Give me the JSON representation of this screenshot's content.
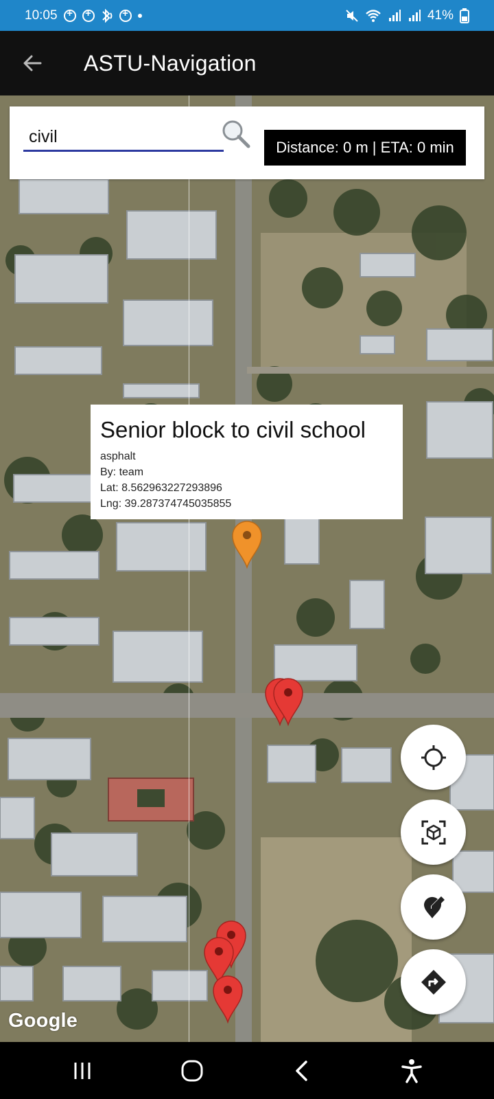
{
  "status_bar": {
    "time": "10:05",
    "battery": "41%",
    "icons": [
      "notification-icon",
      "notification-icon",
      "bluetooth-audio-icon",
      "notification-icon",
      "dot-icon",
      "mute-icon",
      "wifi-icon",
      "signal-icon",
      "signal-icon",
      "battery-icon"
    ]
  },
  "app_bar": {
    "title": "ASTU-Navigation",
    "back_icon": "arrow-left-icon"
  },
  "search": {
    "value": "civil",
    "placeholder": "",
    "search_icon": "magnifier-icon"
  },
  "distance": {
    "label": "Distance: 0 m | ETA: 0 min"
  },
  "info_window": {
    "title": "Senior block to civil school",
    "surface": "asphalt",
    "by": "By: team",
    "lat": "Lat: 8.562963227293896",
    "lng": "Lng: 39.287374745035855"
  },
  "markers": [
    {
      "color": "#f0922a",
      "role": "selected"
    },
    {
      "color": "#e53935",
      "role": "red"
    },
    {
      "color": "#e53935",
      "role": "red"
    },
    {
      "color": "#e53935",
      "role": "red"
    },
    {
      "color": "#e53935",
      "role": "red"
    },
    {
      "color": "#e53935",
      "role": "red"
    }
  ],
  "map": {
    "attribution": "Google"
  },
  "fabs": [
    {
      "name": "my-location-button",
      "icon": "crosshair-icon"
    },
    {
      "name": "ar-view-button",
      "icon": "cube-scan-icon"
    },
    {
      "name": "add-place-button",
      "icon": "pin-edit-icon"
    },
    {
      "name": "directions-button",
      "icon": "directions-icon"
    }
  ],
  "nav_bar": {
    "icons": [
      "recents-icon",
      "home-icon",
      "back-icon",
      "accessibility-icon"
    ]
  },
  "colors": {
    "status_bar": "#1f86c9",
    "app_bar": "#111111",
    "search_underline": "#2d3aa0",
    "marker_orange": "#f0922a",
    "marker_red": "#e53935"
  }
}
